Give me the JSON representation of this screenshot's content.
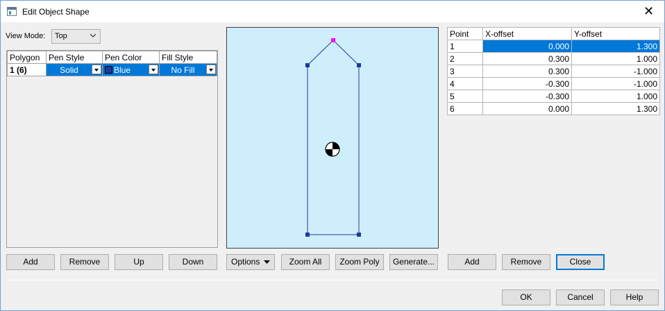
{
  "window": {
    "title": "Edit Object Shape"
  },
  "view_mode": {
    "label": "View Mode:",
    "value": "Top"
  },
  "polygon_table": {
    "headers": [
      "Polygon",
      "Pen Style",
      "Pen Color",
      "Fill Style"
    ],
    "rows": [
      {
        "polygon": "1 (6)",
        "pen_style": "Solid",
        "pen_color": "Blue",
        "fill_style": "No Fill"
      }
    ]
  },
  "polygon_buttons": {
    "add": "Add",
    "remove": "Remove",
    "up": "Up",
    "down": "Down"
  },
  "canvas_buttons": {
    "options": "Options",
    "zoom_all": "Zoom All",
    "zoom_poly": "Zoom Poly",
    "generate": "Generate..."
  },
  "point_table": {
    "headers": [
      "Point",
      "X-offset",
      "Y-offset"
    ],
    "rows": [
      {
        "point": "1",
        "x": "0.000",
        "y": "1.300"
      },
      {
        "point": "2",
        "x": "0.300",
        "y": "1.000"
      },
      {
        "point": "3",
        "x": "0.300",
        "y": "-1.000"
      },
      {
        "point": "4",
        "x": "-0.300",
        "y": "-1.000"
      },
      {
        "point": "5",
        "x": "-0.300",
        "y": "1.000"
      },
      {
        "point": "6",
        "x": "0.000",
        "y": "1.300"
      }
    ]
  },
  "point_buttons": {
    "add": "Add",
    "remove": "Remove",
    "close": "Close"
  },
  "dialog_buttons": {
    "ok": "OK",
    "cancel": "Cancel",
    "help": "Help"
  },
  "colors": {
    "accent": "#0078d7",
    "canvas_bg": "#cfeefc",
    "polygon_line": "#1f3a9e",
    "vertex_highlight": "#ff00ff"
  }
}
